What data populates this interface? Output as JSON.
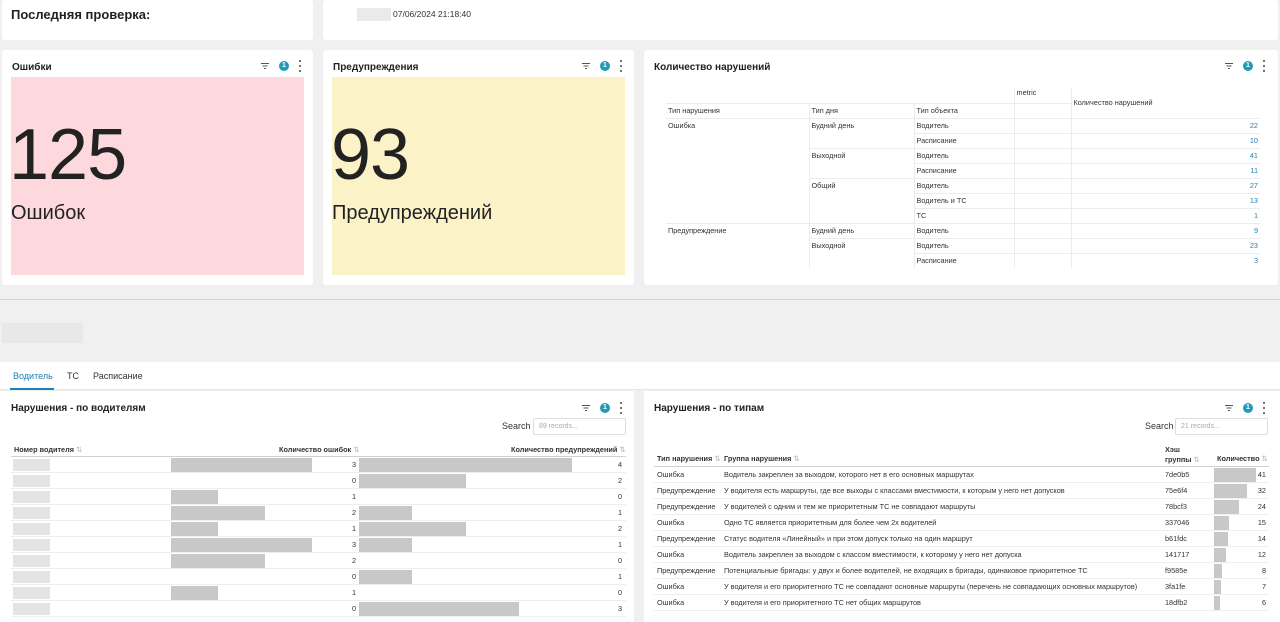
{
  "top": {
    "title": "Последняя проверка:",
    "datetime": "07/06/2024 21:18:40"
  },
  "errors_card": {
    "title": "Ошибки",
    "filter_count": "1",
    "value": "125",
    "label": "Ошибок",
    "bg_color": "#fdd9de"
  },
  "warnings_card": {
    "title": "Предупреждения",
    "filter_count": "1",
    "value": "93",
    "label": "Предупреждений",
    "bg_color": "#fbf2c8"
  },
  "violations_card": {
    "title": "Количество нарушений",
    "filter_count": "1",
    "metric_header": "metric",
    "col_headers": [
      "Тип нарушения",
      "Тип дня",
      "Тип объекта",
      "Количество нарушений"
    ],
    "rows": [
      {
        "type": "Ошибка",
        "day": "Будний день",
        "object": "Водитель",
        "count": "22"
      },
      {
        "type": "",
        "day": "",
        "object": "Расписание",
        "count": "10"
      },
      {
        "type": "",
        "day": "Выходной",
        "object": "Водитель",
        "count": "41"
      },
      {
        "type": "",
        "day": "",
        "object": "Расписание",
        "count": "11"
      },
      {
        "type": "",
        "day": "Общий",
        "object": "Водитель",
        "count": "27"
      },
      {
        "type": "",
        "day": "",
        "object": "Водитель и ТС",
        "count": "13"
      },
      {
        "type": "",
        "day": "",
        "object": "ТС",
        "count": "1"
      },
      {
        "type": "Предупреждение",
        "day": "Будний день",
        "object": "Водитель",
        "count": "9"
      },
      {
        "type": "",
        "day": "Выходной",
        "object": "Водитель",
        "count": "23"
      },
      {
        "type": "",
        "day": "",
        "object": "Расписание",
        "count": "3"
      }
    ]
  },
  "tabs": [
    {
      "label": "Водитель",
      "active": true
    },
    {
      "label": "ТС",
      "active": false
    },
    {
      "label": "Расписание",
      "active": false
    }
  ],
  "drivers_table": {
    "title": "Нарушения - по водителям",
    "filter_count": "1",
    "search_label": "Search",
    "search_placeholder": "89 records...",
    "headers": [
      "Номер водителя",
      "Количество ошибок",
      "Количество предупреждений"
    ],
    "max_errors": 3,
    "max_warnings": 4,
    "rows": [
      {
        "errors": 3,
        "warnings": 4
      },
      {
        "errors": 0,
        "warnings": 2
      },
      {
        "errors": 1,
        "warnings": 0
      },
      {
        "errors": 2,
        "warnings": 1
      },
      {
        "errors": 1,
        "warnings": 2
      },
      {
        "errors": 3,
        "warnings": 1
      },
      {
        "errors": 2,
        "warnings": 0
      },
      {
        "errors": 0,
        "warnings": 1
      },
      {
        "errors": 1,
        "warnings": 0
      },
      {
        "errors": 0,
        "warnings": 3
      }
    ]
  },
  "types_table": {
    "title": "Нарушения - по типам",
    "filter_count": "1",
    "search_label": "Search",
    "search_placeholder": "21 records...",
    "headers": [
      "Тип нарушения",
      "Группа нарушения",
      "Хэш группы",
      "Количество"
    ],
    "max_count": 41,
    "rows": [
      {
        "type": "Ошибка",
        "group": "Водитель закреплен за выходом, которого нет в его основных маршрутах",
        "hash": "7de0b5",
        "count": 41
      },
      {
        "type": "Предупреждение",
        "group": "У водителя есть маршруты, где все выходы с классами вместимости, к которым у него нет допусков",
        "hash": "75e6f4",
        "count": 32
      },
      {
        "type": "Предупреждение",
        "group": "У водителей с одним и тем же приоритетным ТС не совпадают маршруты",
        "hash": "78bcf3",
        "count": 24
      },
      {
        "type": "Ошибка",
        "group": "Одно ТС является приоритетным для более чем 2х водителей",
        "hash": "337046",
        "count": 15
      },
      {
        "type": "Предупреждение",
        "group": "Статус водителя «Линейный» и при этом допуск только на один маршрут",
        "hash": "b61fdc",
        "count": 14
      },
      {
        "type": "Ошибка",
        "group": "Водитель закреплен за выходом с классом вместимости, к которому у него нет допуска",
        "hash": "141717",
        "count": 12
      },
      {
        "type": "Предупреждение",
        "group": "Потенциальные бригады: у двух и более водителей, не входящих в бригады, одинаковое приоритетное ТС",
        "hash": "f9585e",
        "count": 8
      },
      {
        "type": "Ошибка",
        "group": "У водителя и его приоритетного ТС не совпадают основные маршруты (перечень не совпадающих основных маршрутов)",
        "hash": "3fa1fe",
        "count": 7
      },
      {
        "type": "Ошибка",
        "group": "У водителя и его приоритетного ТС нет общих маршрутов",
        "hash": "18dfb2",
        "count": 6
      }
    ]
  }
}
